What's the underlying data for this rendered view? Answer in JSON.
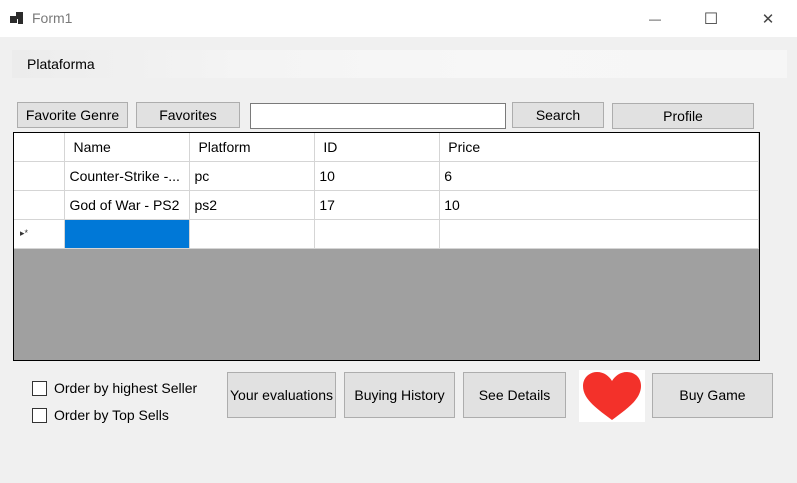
{
  "window": {
    "title": "Form1",
    "minimize_glyph": "—",
    "maximize_glyph": "☐",
    "close_glyph": "✕"
  },
  "menu": {
    "items": [
      {
        "label": "Plataforma"
      }
    ]
  },
  "toolbar": {
    "favorite_genre_label": "Favorite Genre",
    "favorites_label": "Favorites",
    "search_value": "",
    "search_label": "Search",
    "profile_label": "Profile"
  },
  "grid": {
    "columns": [
      "Name",
      "Platform",
      "ID",
      "Price"
    ],
    "rows": [
      [
        "Counter-Strike -...",
        "pc",
        "10",
        "6"
      ],
      [
        "God of War - PS2",
        "ps2",
        "17",
        "10"
      ]
    ],
    "new_row_marker": "▸*",
    "selected_cell": {
      "row": "new",
      "column": "Name"
    }
  },
  "options": {
    "order_highest_seller_label": "Order by highest Seller",
    "order_highest_seller_checked": false,
    "order_top_sells_label": "Order by Top Sells",
    "order_top_sells_checked": false
  },
  "actions": {
    "your_evaluations_label": "Your evaluations",
    "buying_history_label": "Buying History",
    "see_details_label": "See Details",
    "favorite_icon": "heart-icon",
    "buy_game_label": "Buy  Game"
  },
  "colors": {
    "heart": "#f3312a",
    "selection": "#0078d7",
    "grid_background": "#a0a0a0"
  }
}
